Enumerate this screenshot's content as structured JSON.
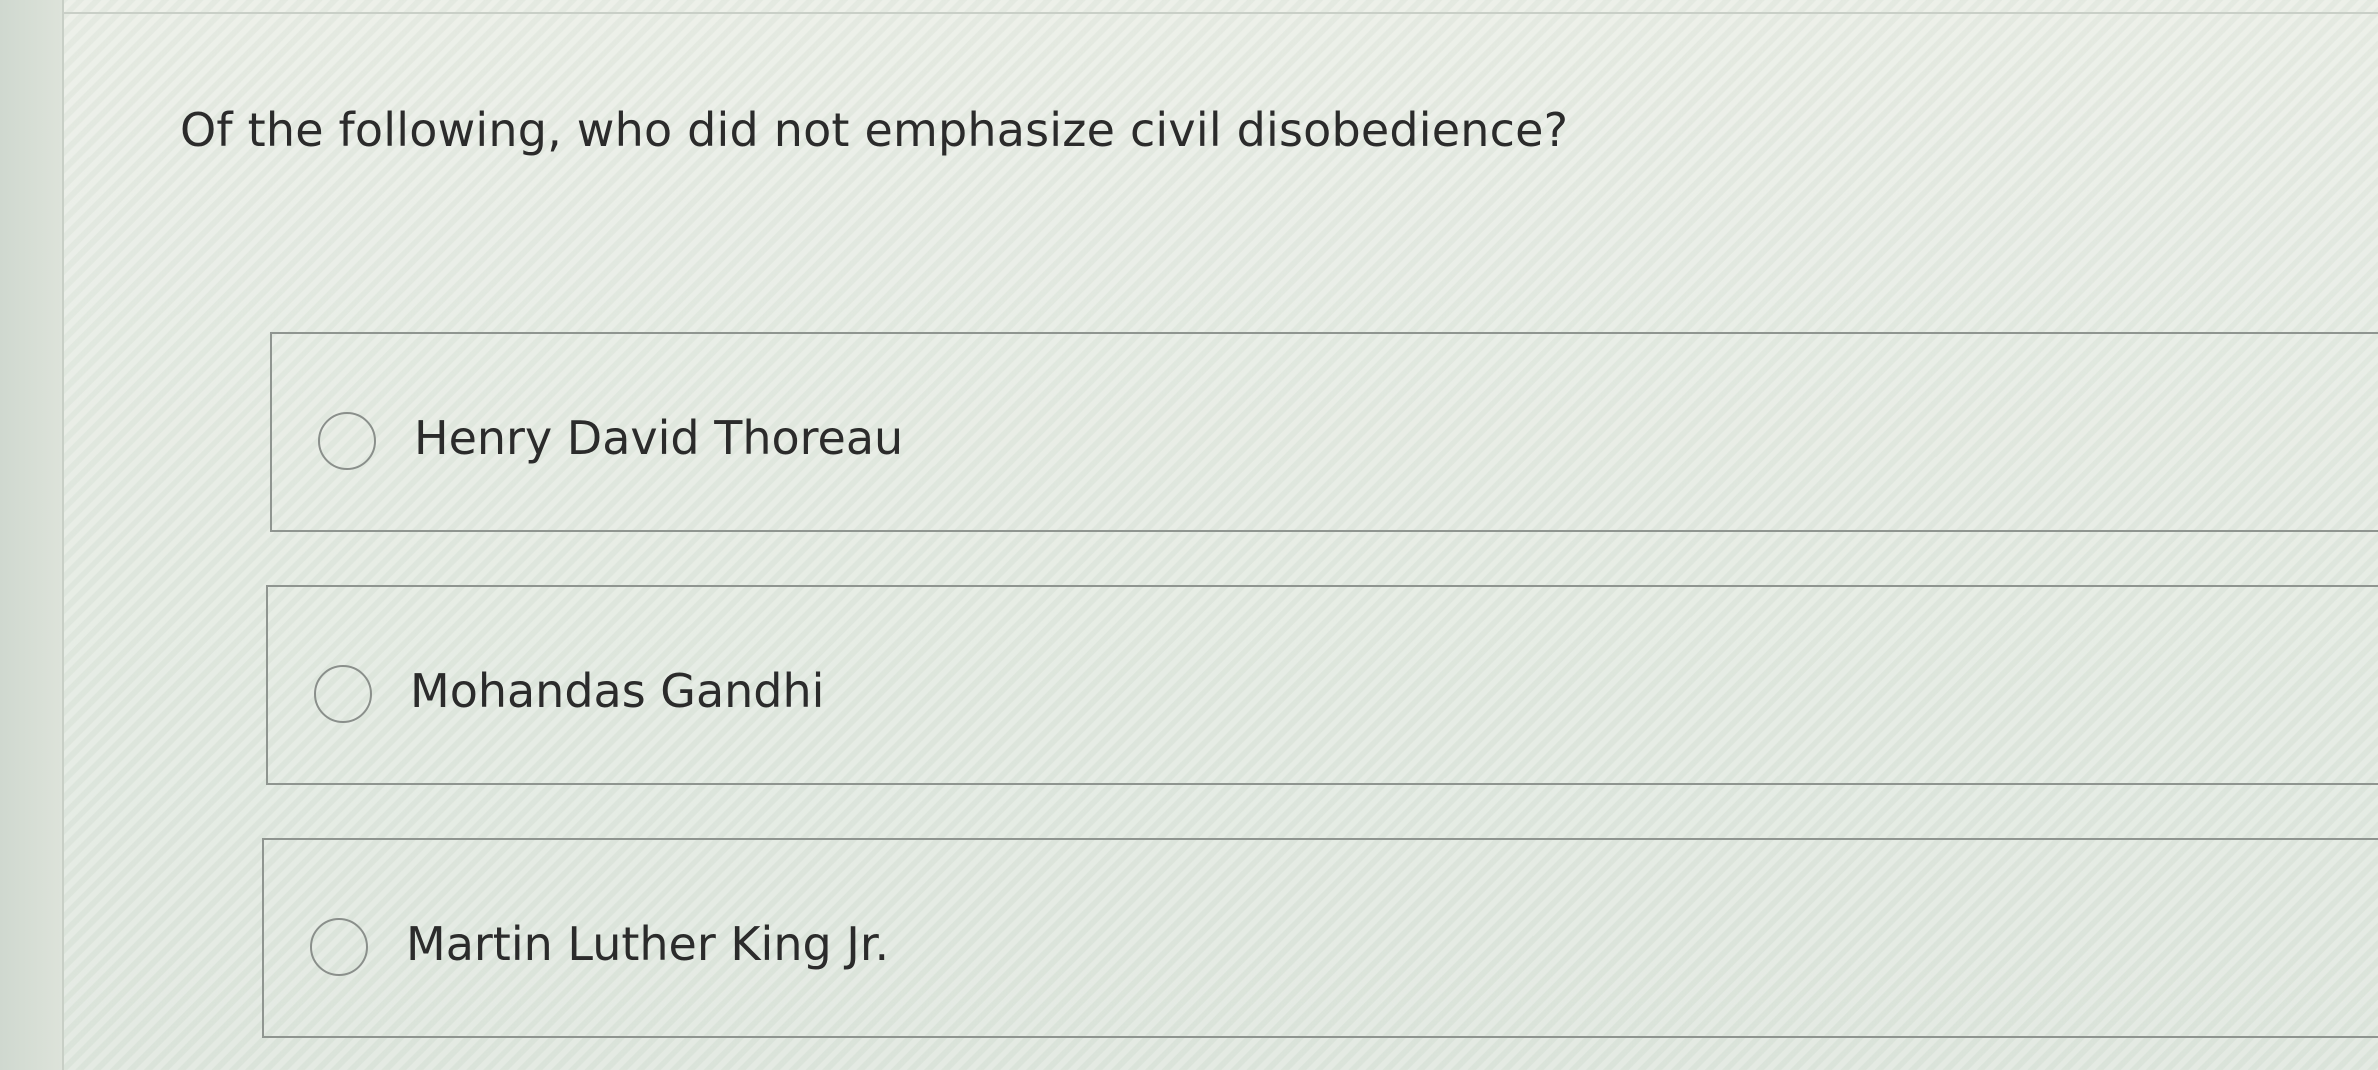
{
  "question": {
    "text": "Of the following, who did not emphasize civil disobedience?"
  },
  "options": [
    {
      "label": "Henry David Thoreau",
      "selected": false
    },
    {
      "label": "Mohandas Gandhi",
      "selected": false
    },
    {
      "label": "Martin Luther King Jr.",
      "selected": false
    }
  ],
  "colors": {
    "border": "#8f9590",
    "text": "#2b2b2b",
    "radio_border": "#8a8f8b"
  }
}
